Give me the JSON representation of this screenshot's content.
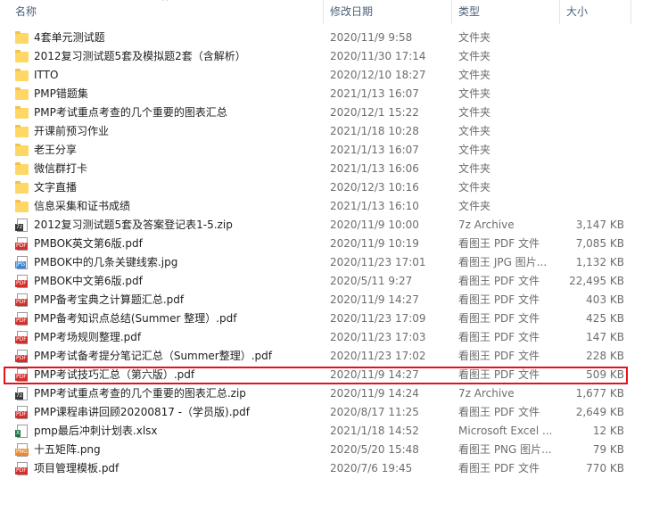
{
  "columns": {
    "name": "名称",
    "modified": "修改日期",
    "type": "类型",
    "size": "大小"
  },
  "sort_indicator": "^",
  "files": [
    {
      "name": "4套单元测试题",
      "date": "2020/11/9 9:58",
      "type": "文件夹",
      "size": "",
      "icon": "folder"
    },
    {
      "name": "2012复习测试题5套及模拟题2套（含解析）",
      "date": "2020/11/30 17:14",
      "type": "文件夹",
      "size": "",
      "icon": "folder"
    },
    {
      "name": "ITTO",
      "date": "2020/12/10 18:27",
      "type": "文件夹",
      "size": "",
      "icon": "folder"
    },
    {
      "name": "PMP错题集",
      "date": "2021/1/13 16:07",
      "type": "文件夹",
      "size": "",
      "icon": "folder"
    },
    {
      "name": "PMP考试重点考查的几个重要的图表汇总",
      "date": "2020/12/1 15:22",
      "type": "文件夹",
      "size": "",
      "icon": "folder"
    },
    {
      "name": "开课前预习作业",
      "date": "2021/1/18 10:28",
      "type": "文件夹",
      "size": "",
      "icon": "folder"
    },
    {
      "name": "老王分享",
      "date": "2021/1/13 16:07",
      "type": "文件夹",
      "size": "",
      "icon": "folder"
    },
    {
      "name": "微信群打卡",
      "date": "2021/1/13 16:06",
      "type": "文件夹",
      "size": "",
      "icon": "folder"
    },
    {
      "name": "文字直播",
      "date": "2020/12/3 10:16",
      "type": "文件夹",
      "size": "",
      "icon": "folder"
    },
    {
      "name": "信息采集和证书成绩",
      "date": "2021/1/13 16:10",
      "type": "文件夹",
      "size": "",
      "icon": "folder"
    },
    {
      "name": "2012复习测试题5套及答案登记表1-5.zip",
      "date": "2020/11/9 10:00",
      "type": "7z Archive",
      "size": "3,147 KB",
      "icon": "zip"
    },
    {
      "name": "PMBOK英文第6版.pdf",
      "date": "2020/11/9 10:19",
      "type": "看图王 PDF 文件",
      "size": "7,085 KB",
      "icon": "pdf"
    },
    {
      "name": "PMBOK中的几条关键线索.jpg",
      "date": "2020/11/23 17:01",
      "type": "看图王 JPG 图片...",
      "size": "1,132 KB",
      "icon": "jpg"
    },
    {
      "name": "PMBOK中文第6版.pdf",
      "date": "2020/5/11 9:27",
      "type": "看图王 PDF 文件",
      "size": "22,495 KB",
      "icon": "pdf"
    },
    {
      "name": "PMP备考宝典之计算题汇总.pdf",
      "date": "2020/11/9 14:27",
      "type": "看图王 PDF 文件",
      "size": "403 KB",
      "icon": "pdf"
    },
    {
      "name": "PMP备考知识点总结(Summer 整理）.pdf",
      "date": "2020/11/23 17:09",
      "type": "看图王 PDF 文件",
      "size": "425 KB",
      "icon": "pdf"
    },
    {
      "name": "PMP考场规则整理.pdf",
      "date": "2020/11/23 17:03",
      "type": "看图王 PDF 文件",
      "size": "147 KB",
      "icon": "pdf"
    },
    {
      "name": "PMP考试备考提分笔记汇总（Summer整理）.pdf",
      "date": "2020/11/23 17:02",
      "type": "看图王 PDF 文件",
      "size": "228 KB",
      "icon": "pdf"
    },
    {
      "name": "PMP考试技巧汇总（第六版）.pdf",
      "date": "2020/11/9 14:27",
      "type": "看图王 PDF 文件",
      "size": "509 KB",
      "icon": "pdf",
      "highlighted": true
    },
    {
      "name": "PMP考试重点考查的几个重要的图表汇总.zip",
      "date": "2020/11/9 14:24",
      "type": "7z Archive",
      "size": "1,677 KB",
      "icon": "zip"
    },
    {
      "name": "PMP课程串讲回顾20200817 -（学员版).pdf",
      "date": "2020/8/17 11:25",
      "type": "看图王 PDF 文件",
      "size": "2,649 KB",
      "icon": "pdf"
    },
    {
      "name": "pmp最后冲刺计划表.xlsx",
      "date": "2021/1/18 14:52",
      "type": "Microsoft Excel ...",
      "size": "12 KB",
      "icon": "xls"
    },
    {
      "name": "十五矩阵.png",
      "date": "2020/5/20 15:48",
      "type": "看图王 PNG 图片...",
      "size": "79 KB",
      "icon": "png"
    },
    {
      "name": "项目管理模板.pdf",
      "date": "2020/7/6 19:45",
      "type": "看图王 PDF 文件",
      "size": "770 KB",
      "icon": "pdf"
    }
  ],
  "icon_badges": {
    "pdf": "PDF",
    "jpg": "JPG",
    "png": "PNG",
    "zip": "7z",
    "xls": "X"
  },
  "colors": {
    "highlight_border": "#e0141b",
    "folder": "#ffd764",
    "header_text": "#4c607a",
    "meta_text": "#6d6d6d"
  }
}
